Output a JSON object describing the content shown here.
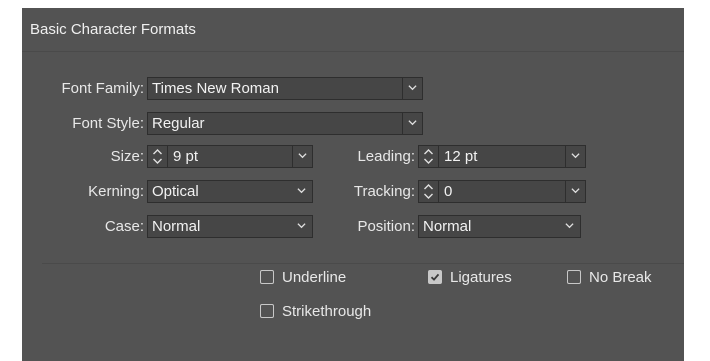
{
  "panel": {
    "title": "Basic Character Formats"
  },
  "fields": {
    "font_family": {
      "label": "Font Family:",
      "value": "Times New Roman"
    },
    "font_style": {
      "label": "Font Style:",
      "value": "Regular"
    },
    "size": {
      "label": "Size:",
      "value": "9 pt"
    },
    "leading": {
      "label": "Leading:",
      "value": "12 pt"
    },
    "kerning": {
      "label": "Kerning:",
      "value": "Optical"
    },
    "tracking": {
      "label": "Tracking:",
      "value": "0"
    },
    "case": {
      "label": "Case:",
      "value": "Normal"
    },
    "position": {
      "label": "Position:",
      "value": "Normal"
    }
  },
  "checkboxes": {
    "underline": {
      "label": "Underline",
      "checked": false
    },
    "ligatures": {
      "label": "Ligatures",
      "checked": true
    },
    "no_break": {
      "label": "No Break",
      "checked": false
    },
    "strikethrough": {
      "label": "Strikethrough",
      "checked": false
    }
  },
  "colors": {
    "panel_bg": "#535353",
    "field_bg": "#464646",
    "text": "#e8e8e8"
  }
}
